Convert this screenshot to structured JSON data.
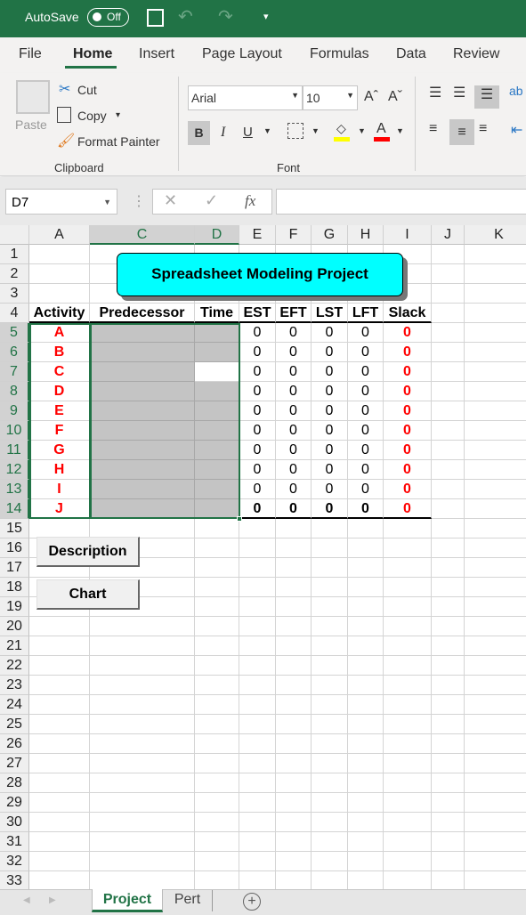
{
  "titlebar": {
    "autosave_label": "AutoSave",
    "autosave_state": "Off"
  },
  "menu_tabs": [
    "File",
    "Home",
    "Insert",
    "Page Layout",
    "Formulas",
    "Data",
    "Review"
  ],
  "active_tab": "Home",
  "clipboard": {
    "paste": "Paste",
    "cut": "Cut",
    "copy": "Copy",
    "format_painter": "Format Painter",
    "group": "Clipboard"
  },
  "font": {
    "name": "Arial",
    "size": "10",
    "group": "Font",
    "bold": "B",
    "italic": "I",
    "underline": "U",
    "font_color_glyph": "A",
    "fill_color": "#ffff00",
    "font_color": "#ff0000"
  },
  "formula_bar": {
    "name_box": "D7",
    "fx": "fx",
    "value": ""
  },
  "columns": [
    "A",
    "C",
    "D",
    "E",
    "F",
    "G",
    "H",
    "I",
    "J",
    "K"
  ],
  "selected_columns": [
    "C",
    "D"
  ],
  "title_box": "Spreadsheet Modeling Project",
  "headers": [
    "Activity",
    "Predecessor",
    "Time",
    "EST",
    "EFT",
    "LST",
    "LFT",
    "Slack"
  ],
  "activities": [
    {
      "activity": "A",
      "est": "0",
      "eft": "0",
      "lst": "0",
      "lft": "0",
      "slack": "0"
    },
    {
      "activity": "B",
      "est": "0",
      "eft": "0",
      "lst": "0",
      "lft": "0",
      "slack": "0"
    },
    {
      "activity": "C",
      "est": "0",
      "eft": "0",
      "lst": "0",
      "lft": "0",
      "slack": "0"
    },
    {
      "activity": "D",
      "est": "0",
      "eft": "0",
      "lst": "0",
      "lft": "0",
      "slack": "0"
    },
    {
      "activity": "E",
      "est": "0",
      "eft": "0",
      "lst": "0",
      "lft": "0",
      "slack": "0"
    },
    {
      "activity": "F",
      "est": "0",
      "eft": "0",
      "lst": "0",
      "lft": "0",
      "slack": "0"
    },
    {
      "activity": "G",
      "est": "0",
      "eft": "0",
      "lst": "0",
      "lft": "0",
      "slack": "0"
    },
    {
      "activity": "H",
      "est": "0",
      "eft": "0",
      "lst": "0",
      "lft": "0",
      "slack": "0"
    },
    {
      "activity": "I",
      "est": "0",
      "eft": "0",
      "lst": "0",
      "lft": "0",
      "slack": "0"
    },
    {
      "activity": "J",
      "est": "0",
      "eft": "0",
      "lst": "0",
      "lft": "0",
      "slack": "0"
    }
  ],
  "buttons": {
    "description": "Description",
    "chart": "Chart"
  },
  "row_count": 33,
  "sheet_tabs": [
    "Project",
    "Pert"
  ],
  "active_sheet": "Project",
  "colors": {
    "excel_green": "#217346",
    "title_box": "#00ffff",
    "activity_text": "#ff0000",
    "input_fill": "#c4c4c4"
  }
}
